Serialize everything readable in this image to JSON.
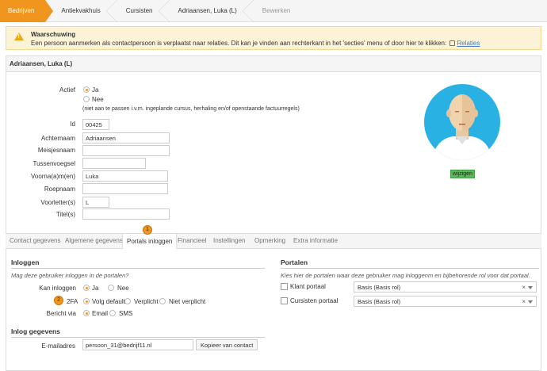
{
  "breadcrumb": [
    "Bedrijven",
    "Antiekvakhuis",
    "Cursisten",
    "Adriaansen, Luka (L)",
    "Bewerken"
  ],
  "warning": {
    "title": "Waarschuwing",
    "message": "Een persoon aanmerken als contactpersoon is verplaatst naar relaties. Dit kan je vinden aan rechterkant in het 'secties' menu of door hier te klikken:",
    "link": "Relaties"
  },
  "panel_title": "Adriaansen, Luka (L)",
  "form": {
    "actief_label": "Actief",
    "ja": "Ja",
    "nee": "Nee",
    "nee_note": "(niet aan te passen i.v.m. ingeplande cursus, herhaling en/of openstaande factuurregels)",
    "id_label": "Id",
    "id_value": "00425",
    "achternaam_label": "Achternaam",
    "achternaam_value": "Adriaansen",
    "meisjesnaam_label": "Meisjesnaam",
    "meisjesnaam_value": "",
    "tussenvoegsel_label": "Tussenvoegsel",
    "tussenvoegsel_value": "",
    "voornaam_label": "Voorna(a)m(en)",
    "voornaam_value": "Luka",
    "roepnaam_label": "Roepnaam",
    "roepnaam_value": "",
    "voorletters_label": "Voorletter(s)",
    "voorletters_value": "L",
    "titel_label": "Titel(s)",
    "titel_value": ""
  },
  "wijzigen": "wijzigen",
  "tabs": [
    "Contact gegevens",
    "Algemene gegevens",
    "Portals inloggen",
    "Financieel",
    "Instellingen",
    "Opmerking",
    "Extra informatie"
  ],
  "active_tab": 2,
  "tab_badge": "1",
  "inloggen": {
    "title": "Inloggen",
    "hint": "Mag deze gebruiker inloggen in de portalen?",
    "kan_label": "Kan inloggen",
    "ja": "Ja",
    "nee": "Nee",
    "fa_badge": "2",
    "fa_label": "2FA",
    "fa_options": [
      "Volg default",
      "Verplicht",
      "Niet verplicht"
    ],
    "bericht_label": "Bericht via",
    "bericht_options": [
      "Email",
      "SMS"
    ]
  },
  "inlog_gegevens": {
    "title": "Inlog gegevens",
    "email_label": "E-mailadres",
    "email_value": "persoon_31@bedrijf11.nl",
    "copy_button": "Kopieer van contact"
  },
  "portalen": {
    "title": "Portalen",
    "hint": "Kies hier de portalen waar deze gebruiker mag inloggenm en bijbehorende rol voor dat portaal.",
    "items": [
      {
        "label": "Klant portaal",
        "role": "Basis (Basis rol)"
      },
      {
        "label": "Cursisten portaal",
        "role": "Basis (Basis rol)"
      }
    ]
  },
  "colors": {
    "accent": "#f0961e",
    "avatar_bg": "#29b1e3",
    "wijzigen": "#5cb85c"
  }
}
